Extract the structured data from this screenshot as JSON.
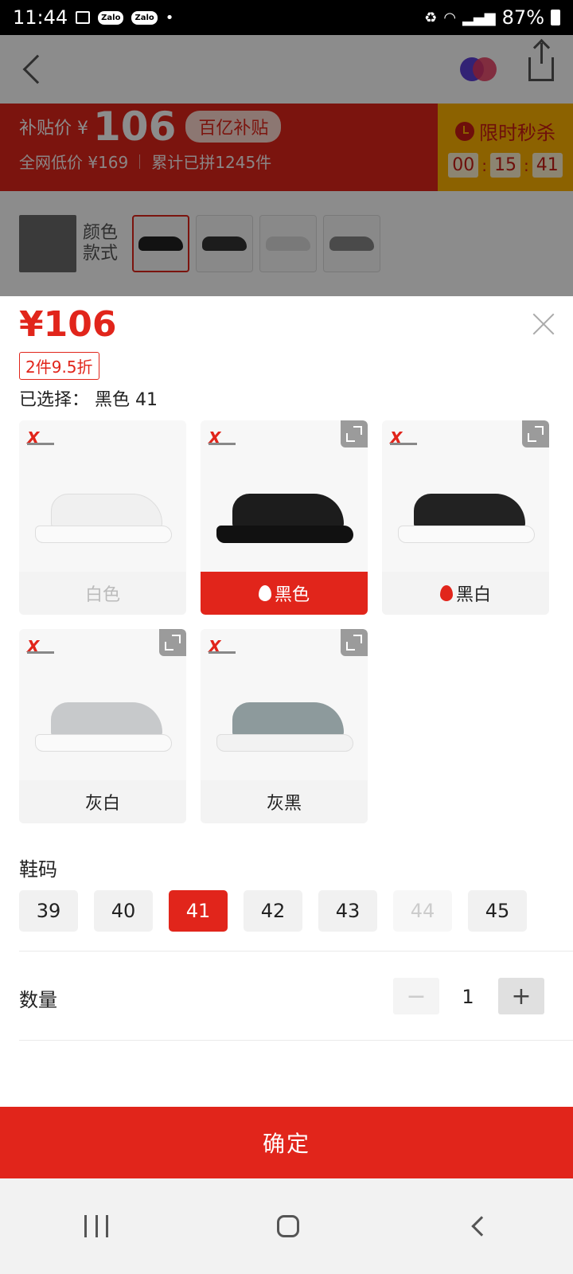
{
  "status_bar": {
    "time": "11:44",
    "notifications": [
      "image-icon",
      "zalo-icon",
      "zalo-icon",
      "dot-icon"
    ],
    "zalo_label": "Zalo",
    "battery": "87%"
  },
  "background_page": {
    "promo": {
      "price_label": "补贴价 ¥",
      "price": "106",
      "badge": "百亿补贴",
      "lowest_price": "全网低价 ¥169",
      "total_sold": "累计已拼1245件",
      "flash_title": "限时秒杀",
      "countdown": [
        "00",
        "15",
        "41"
      ]
    },
    "style_label_line1": "颜色",
    "style_label_line2": "款式"
  },
  "sheet": {
    "price": "¥106",
    "discount_tag": "2件9.5折",
    "selected_prefix": "已选择：",
    "selected_value": "黑色 41",
    "colors": [
      {
        "name": "白色",
        "state": "disabled",
        "hot": false
      },
      {
        "name": "黑色",
        "state": "selected",
        "hot": true
      },
      {
        "name": "黑白",
        "state": "normal",
        "hot": true
      },
      {
        "name": "灰白",
        "state": "normal",
        "hot": false
      },
      {
        "name": "灰黑",
        "state": "normal",
        "hot": false
      }
    ],
    "brand_mark": "X",
    "size_title": "鞋码",
    "sizes": [
      {
        "label": "39",
        "state": "normal"
      },
      {
        "label": "40",
        "state": "normal"
      },
      {
        "label": "41",
        "state": "selected"
      },
      {
        "label": "42",
        "state": "normal"
      },
      {
        "label": "43",
        "state": "normal"
      },
      {
        "label": "44",
        "state": "disabled"
      },
      {
        "label": "45",
        "state": "normal"
      }
    ],
    "qty_title": "数量",
    "qty_value": "1",
    "qty_minus": "−",
    "qty_plus": "+",
    "confirm": "确定"
  },
  "colors": {
    "accent": "#e1251b",
    "flash_bg": "#ffb300"
  }
}
